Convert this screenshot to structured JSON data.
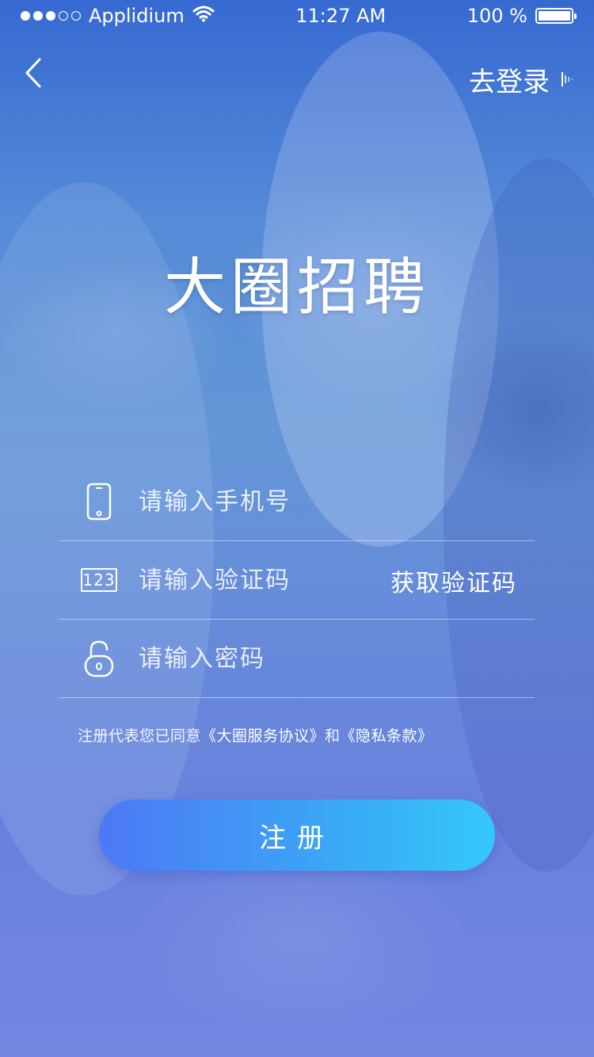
{
  "status_bar": {
    "carrier": "Applidium",
    "time": "11:27 AM",
    "battery": "100 %",
    "battery_level": 1.0
  },
  "nav": {
    "back_icon": "chevron-left-icon",
    "login_label": "去登录",
    "login_icon": "sound-wave-icon"
  },
  "app_title": "大圈招聘",
  "form": {
    "phone": {
      "placeholder": "请输入手机号",
      "value": "",
      "icon": "phone-icon"
    },
    "code": {
      "placeholder": "请输入验证码",
      "value": "",
      "icon": "number-123-icon",
      "icon_text": "123",
      "get_code_label": "获取验证码"
    },
    "password": {
      "placeholder": "请输入密码",
      "value": "",
      "icon": "lock-icon"
    }
  },
  "agreement": {
    "prefix": "注册代表您已同意",
    "service_terms": "《大圈服务协议》",
    "conjunction": "和",
    "privacy_terms": "《隐私条款》"
  },
  "register_button": {
    "label": "注册"
  },
  "colors": {
    "button_start": "#4d78f5",
    "button_end": "#35c8fb",
    "text": "#ffffff"
  }
}
